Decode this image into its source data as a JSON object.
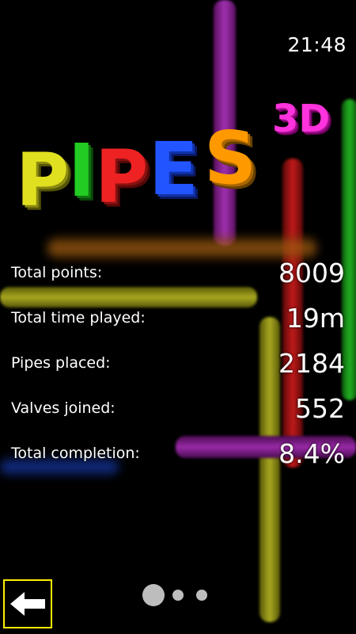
{
  "status_bar": {
    "time": "21:48"
  },
  "logo": {
    "letters": [
      "P",
      "I",
      "P",
      "E",
      "S"
    ],
    "suffix": "3D"
  },
  "stats": [
    {
      "label": "Total points:",
      "value": "8009"
    },
    {
      "label": "Total time played:",
      "value": "19m"
    },
    {
      "label": "Pipes placed:",
      "value": "2184"
    },
    {
      "label": "Valves joined:",
      "value": "552"
    },
    {
      "label": "Total completion:",
      "value": "8.4%"
    }
  ],
  "pager": {
    "pages": 3,
    "current": 1
  },
  "back_icon": "left-arrow-icon",
  "colors": {
    "back_border": "#ffee00",
    "logo": [
      "#e0e020",
      "#22cc22",
      "#ee2222",
      "#2255ff",
      "#ff9900"
    ],
    "logo_3d": "#ff33dd"
  }
}
